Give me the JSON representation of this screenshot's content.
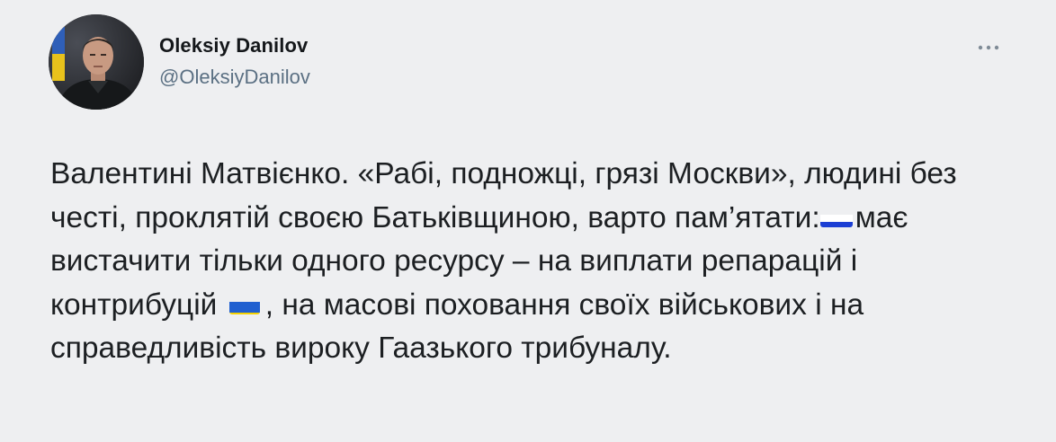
{
  "author": {
    "display_name": "Oleksiy Danilov",
    "handle": "@OleksiyDanilov",
    "avatar_icon": "profile-photo-avatar"
  },
  "menu": {
    "icon": "more-horizontal-icon"
  },
  "tweet": {
    "segments": [
      "Валентині Матвієнко. «Рабі, подножці, грязі Москви», людині без честі, проклятій своєю Батьківщиною, варто пам’ятати:",
      "має вистачити тільки одного ресурсу – на виплати репарацій і контрибуцій",
      ", на масові поховання своїх військових і на справедливість вироку Гаазького трибуналу."
    ],
    "emoji": {
      "first": "russia-flag-emoji",
      "second": "ukraine-flag-emoji"
    }
  },
  "colors": {
    "background": "#eeeff1",
    "text": "#1c1f22",
    "handle": "#5b7083",
    "ru_white": "#ffffff",
    "ru_blue": "#1c3fd4",
    "ru_red": "#e0232e",
    "ua_blue": "#1f5fd0",
    "ua_yellow": "#f5d200"
  }
}
